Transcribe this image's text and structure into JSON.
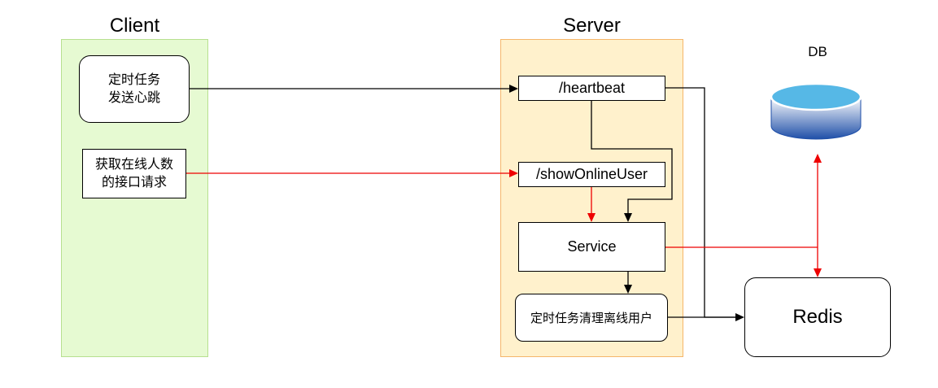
{
  "client": {
    "title": "Client",
    "color_fill": "#e6fad2",
    "color_stroke": "#b7e08f",
    "timer_box": "定时任务\n发送心跳",
    "query_box": "获取在线人数\n的接口请求"
  },
  "server": {
    "title": "Server",
    "color_fill": "#fff1cc",
    "color_stroke": "#f5b66a",
    "heartbeat": "/heartbeat",
    "show_online": "/showOnlineUser",
    "service": "Service",
    "cleanup_task": "定时任务清理离线用户"
  },
  "db": {
    "label": "DB",
    "color_top": "#56b8e6",
    "color_body": "#1f4fa8"
  },
  "redis": {
    "label": "Redis"
  },
  "colors": {
    "black_line": "#000000",
    "red_line": "#ee0000"
  }
}
